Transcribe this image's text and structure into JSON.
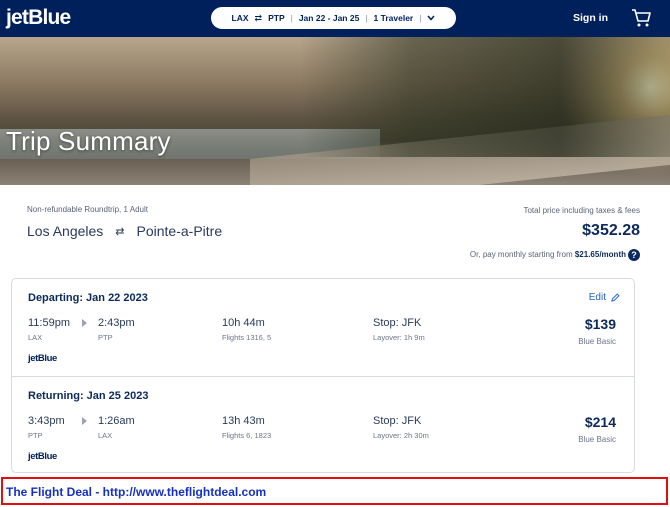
{
  "header": {
    "logo": "jetBlue",
    "search": {
      "origin": "LAX",
      "swap": "⇄",
      "destination": "PTP",
      "dates": "Jan 22 - Jan 25",
      "travelers": "1 Traveler"
    },
    "signin_label": "Sign in"
  },
  "hero": {
    "title": "Trip Summary"
  },
  "summary": {
    "trip_type": "Non-refundable Roundtrip, 1 Adult",
    "origin_city": "Los Angeles",
    "destination_city": "Pointe-a-Pitre",
    "total_label": "Total price including taxes & fees",
    "total_price": "$352.28",
    "monthly_prefix": "Or, pay monthly starting from",
    "monthly_amount": "$21.65/month"
  },
  "flights": {
    "edit_label": "Edit",
    "departing": {
      "heading": "Departing: Jan 22 2023",
      "depart_time": "11:59pm",
      "depart_code": "LAX",
      "arrive_time": "2:43pm",
      "arrive_code": "PTP",
      "duration": "10h 44m",
      "flight_numbers": "Flights 1316, 5",
      "stop": "Stop: JFK",
      "layover": "Layover: 1h 9m",
      "price": "$139",
      "fare": "Blue Basic",
      "airline": "jetBlue"
    },
    "returning": {
      "heading": "Returning: Jan 25 2023",
      "depart_time": "3:43pm",
      "depart_code": "PTP",
      "arrive_time": "1:26am",
      "arrive_code": "LAX",
      "duration": "13h 43m",
      "flight_numbers": "Flights 6, 1823",
      "stop": "Stop: JFK",
      "layover": "Layover: 2h 30m",
      "price": "$214",
      "fare": "Blue Basic",
      "airline": "jetBlue"
    }
  },
  "banner": {
    "text": "The Flight Deal - http://www.theflightdeal.com"
  },
  "colors": {
    "brand_navy": "#00205b",
    "link_blue": "#2563c7",
    "banner_border": "#e01010",
    "banner_text": "#1530c8"
  },
  "icons": {
    "swap": "swap-arrows-icon",
    "chevron": "chevron-down-icon",
    "cart": "cart-icon",
    "help": "help-circle-icon",
    "edit": "pencil-icon"
  }
}
